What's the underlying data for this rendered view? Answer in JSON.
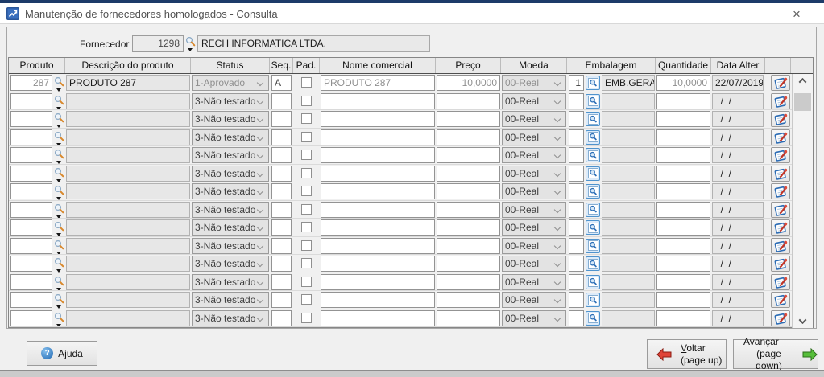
{
  "window": {
    "title": "Manutenção de fornecedores homologados - Consulta",
    "close": "×"
  },
  "supplier": {
    "label": "Fornecedor",
    "code": "1298",
    "name": "RECH INFORMATICA LTDA."
  },
  "table": {
    "headers": [
      "Produto",
      "Descrição do produto",
      "Status",
      "Seq.",
      "Pad.",
      "Nome comercial",
      "Preço",
      "Moeda",
      "Embalagem",
      "Quantidade",
      "Data Alter"
    ],
    "rows": [
      {
        "produto": "287",
        "descricao": "PRODUTO 287",
        "status": "1-Aprovado",
        "seq": "A",
        "pad": false,
        "nome": "PRODUTO 287",
        "preco": "10,0000",
        "moeda": "00-Real",
        "emb_num": "1",
        "embalagem": "EMB.GERAL",
        "quantidade": "10,0000",
        "data": "22/07/2019"
      },
      {
        "produto": "",
        "descricao": "",
        "status": "3-Não testado",
        "seq": "",
        "pad": false,
        "nome": "",
        "preco": "",
        "moeda": "00-Real",
        "emb_num": "",
        "embalagem": "",
        "quantidade": "",
        "data": "  /  /"
      },
      {
        "produto": "",
        "descricao": "",
        "status": "3-Não testado",
        "seq": "",
        "pad": false,
        "nome": "",
        "preco": "",
        "moeda": "00-Real",
        "emb_num": "",
        "embalagem": "",
        "quantidade": "",
        "data": "  /  /"
      },
      {
        "produto": "",
        "descricao": "",
        "status": "3-Não testado",
        "seq": "",
        "pad": false,
        "nome": "",
        "preco": "",
        "moeda": "00-Real",
        "emb_num": "",
        "embalagem": "",
        "quantidade": "",
        "data": "  /  /"
      },
      {
        "produto": "",
        "descricao": "",
        "status": "3-Não testado",
        "seq": "",
        "pad": false,
        "nome": "",
        "preco": "",
        "moeda": "00-Real",
        "emb_num": "",
        "embalagem": "",
        "quantidade": "",
        "data": "  /  /"
      },
      {
        "produto": "",
        "descricao": "",
        "status": "3-Não testado",
        "seq": "",
        "pad": false,
        "nome": "",
        "preco": "",
        "moeda": "00-Real",
        "emb_num": "",
        "embalagem": "",
        "quantidade": "",
        "data": "  /  /"
      },
      {
        "produto": "",
        "descricao": "",
        "status": "3-Não testado",
        "seq": "",
        "pad": false,
        "nome": "",
        "preco": "",
        "moeda": "00-Real",
        "emb_num": "",
        "embalagem": "",
        "quantidade": "",
        "data": "  /  /"
      },
      {
        "produto": "",
        "descricao": "",
        "status": "3-Não testado",
        "seq": "",
        "pad": false,
        "nome": "",
        "preco": "",
        "moeda": "00-Real",
        "emb_num": "",
        "embalagem": "",
        "quantidade": "",
        "data": "  /  /"
      },
      {
        "produto": "",
        "descricao": "",
        "status": "3-Não testado",
        "seq": "",
        "pad": false,
        "nome": "",
        "preco": "",
        "moeda": "00-Real",
        "emb_num": "",
        "embalagem": "",
        "quantidade": "",
        "data": "  /  /"
      },
      {
        "produto": "",
        "descricao": "",
        "status": "3-Não testado",
        "seq": "",
        "pad": false,
        "nome": "",
        "preco": "",
        "moeda": "00-Real",
        "emb_num": "",
        "embalagem": "",
        "quantidade": "",
        "data": "  /  /"
      },
      {
        "produto": "",
        "descricao": "",
        "status": "3-Não testado",
        "seq": "",
        "pad": false,
        "nome": "",
        "preco": "",
        "moeda": "00-Real",
        "emb_num": "",
        "embalagem": "",
        "quantidade": "",
        "data": "  /  /"
      },
      {
        "produto": "",
        "descricao": "",
        "status": "3-Não testado",
        "seq": "",
        "pad": false,
        "nome": "",
        "preco": "",
        "moeda": "00-Real",
        "emb_num": "",
        "embalagem": "",
        "quantidade": "",
        "data": "  /  /"
      },
      {
        "produto": "",
        "descricao": "",
        "status": "3-Não testado",
        "seq": "",
        "pad": false,
        "nome": "",
        "preco": "",
        "moeda": "00-Real",
        "emb_num": "",
        "embalagem": "",
        "quantidade": "",
        "data": "  /  /"
      },
      {
        "produto": "",
        "descricao": "",
        "status": "3-Não testado",
        "seq": "",
        "pad": false,
        "nome": "",
        "preco": "",
        "moeda": "00-Real",
        "emb_num": "",
        "embalagem": "",
        "quantidade": "",
        "data": "  /  /"
      }
    ]
  },
  "footer": {
    "help": {
      "icon": "?",
      "pre": "A",
      "mn": "j",
      "rest": "uda"
    },
    "back": {
      "mn": "V",
      "rest": "oltar",
      "sub": "(page up)"
    },
    "forward": {
      "mn": "A",
      "rest": "vançar",
      "sub": "(page down)"
    }
  },
  "colors": {
    "accent_blue": "#2466c8",
    "back_arrow_red": "#e04438",
    "forward_arrow_green": "#56be3a",
    "titlebar_strip": "#1d3b69",
    "field_gray": "#e7e7e7"
  }
}
